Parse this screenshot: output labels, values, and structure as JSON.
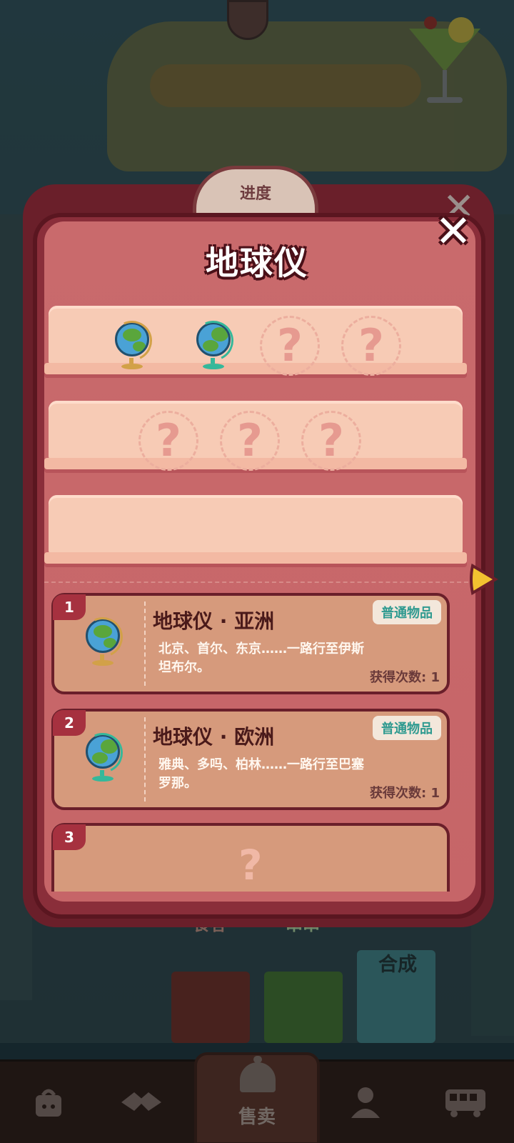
{
  "modal": {
    "title": "地球仪",
    "close_label": "✕",
    "progress_badge": "进度"
  },
  "shelves": [
    {
      "slots": [
        "globe-asia",
        "globe-europe",
        "unknown",
        "unknown"
      ]
    },
    {
      "slots": [
        "unknown",
        "unknown",
        "unknown"
      ]
    },
    {
      "slots": []
    }
  ],
  "unknown_mark": "?",
  "items": [
    {
      "index": "1",
      "name": "地球仪 · 亚洲",
      "rarity": "普通物品",
      "description": "北京、首尔、东京……一路行至伊斯坦布尔。",
      "obtained": "获得次数: 1",
      "icon": "globe-asia-icon"
    },
    {
      "index": "2",
      "name": "地球仪 · 欧洲",
      "rarity": "普通物品",
      "description": "雅典、多吗、柏林……一路行至巴塞罗那。",
      "obtained": "获得次数: 1",
      "icon": "globe-europe-icon"
    },
    {
      "index": "3",
      "locked_mark": "?"
    }
  ],
  "background": {
    "sign_food": "食客",
    "sign_chuan": "串串",
    "sign_synth": "合成"
  },
  "bottom_nav": {
    "sell_label": "售卖",
    "items": [
      {
        "icon": "bag-icon"
      },
      {
        "icon": "handshake-icon"
      },
      {
        "icon": "bell-icon"
      },
      {
        "icon": "person-icon"
      },
      {
        "icon": "bus-icon"
      }
    ]
  },
  "colors": {
    "modal_bg": "#c96a6c",
    "modal_border": "#6a1f2a",
    "shelf": "#f7cbb5",
    "badge_text": "#2f9a90"
  }
}
